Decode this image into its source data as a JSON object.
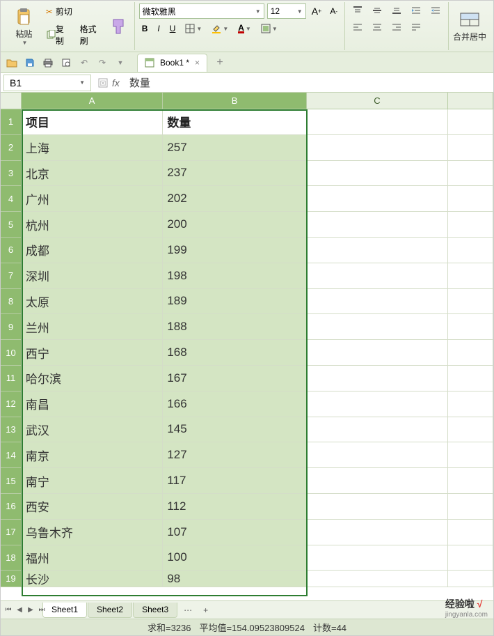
{
  "toolbar": {
    "paste": "粘贴",
    "cut": "剪切",
    "copy": "复制",
    "format_painter": "格式刷",
    "font_name": "微软雅黑",
    "font_size": "12",
    "merge_center": "合并居中"
  },
  "quick_access": {
    "doc_name": "Book1 *"
  },
  "fx": {
    "cell_ref": "B1",
    "formula": "数量"
  },
  "columns": [
    "A",
    "B",
    "C"
  ],
  "headers": {
    "a": "项目",
    "b": "数量"
  },
  "rows": [
    {
      "n": 1,
      "a": "项目",
      "b": "数量",
      "hdr": true
    },
    {
      "n": 2,
      "a": "上海",
      "b": "257"
    },
    {
      "n": 3,
      "a": "北京",
      "b": "237"
    },
    {
      "n": 4,
      "a": "广州",
      "b": "202"
    },
    {
      "n": 5,
      "a": "杭州",
      "b": "200"
    },
    {
      "n": 6,
      "a": "成都",
      "b": "199"
    },
    {
      "n": 7,
      "a": "深圳",
      "b": "198"
    },
    {
      "n": 8,
      "a": "太原",
      "b": "189"
    },
    {
      "n": 9,
      "a": "兰州",
      "b": "188"
    },
    {
      "n": 10,
      "a": "西宁",
      "b": "168"
    },
    {
      "n": 11,
      "a": "哈尔滨",
      "b": "167"
    },
    {
      "n": 12,
      "a": "南昌",
      "b": "166"
    },
    {
      "n": 13,
      "a": "武汉",
      "b": "145"
    },
    {
      "n": 14,
      "a": "南京",
      "b": "127"
    },
    {
      "n": 15,
      "a": "南宁",
      "b": "117"
    },
    {
      "n": 16,
      "a": "西安",
      "b": "112"
    },
    {
      "n": 17,
      "a": "乌鲁木齐",
      "b": "107"
    },
    {
      "n": 18,
      "a": "福州",
      "b": "100"
    },
    {
      "n": 19,
      "a": "长沙",
      "b": "98"
    }
  ],
  "sheets": [
    "Sheet1",
    "Sheet2",
    "Sheet3"
  ],
  "status": {
    "sum_label": "求和",
    "sum": "3236",
    "avg_label": "平均值",
    "avg": "154.09523809524",
    "count_label": "计数",
    "count": "44"
  },
  "watermark": {
    "text": "经验啦",
    "sub": "jingyanla.com"
  }
}
